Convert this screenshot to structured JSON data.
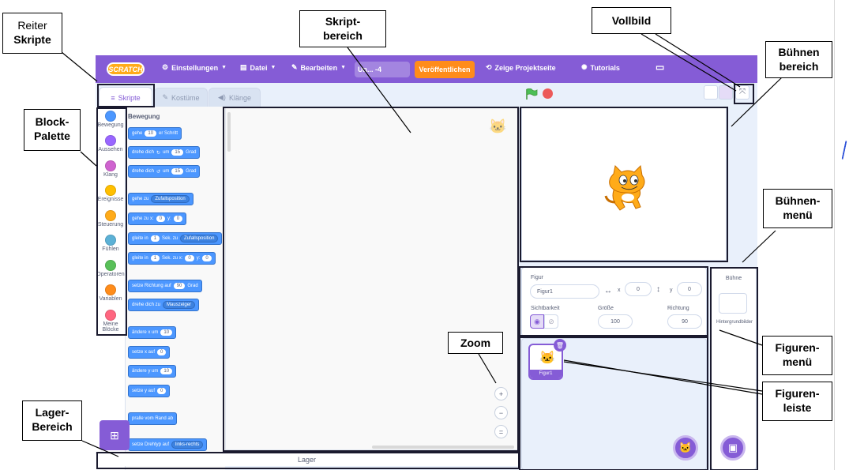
{
  "menubar": {
    "logo": "SCRATCH",
    "settings": "Einstellungen",
    "file": "Datei",
    "edit": "Bearbeiten",
    "project_title": "Un... -4",
    "publish": "Veröffentlichen",
    "project_page": "Zeige Projektseite",
    "tutorials": "Tutorials",
    "accent": "#855cd6",
    "publish_color": "#ff8c1a"
  },
  "tabs": {
    "scripts": "Skripte",
    "costumes": "Kostüme",
    "sounds": "Klänge"
  },
  "categories": [
    {
      "label": "Bewegung",
      "color": "#4c97ff"
    },
    {
      "label": "Aussehen",
      "color": "#9966ff"
    },
    {
      "label": "Klang",
      "color": "#cf63cf"
    },
    {
      "label": "Ereignisse",
      "color": "#ffbf00"
    },
    {
      "label": "Steuerung",
      "color": "#ffab19"
    },
    {
      "label": "Fühlen",
      "color": "#5cb1d6"
    },
    {
      "label": "Operatoren",
      "color": "#59c059"
    },
    {
      "label": "Variablen",
      "color": "#ff8c1a"
    },
    {
      "label": "Meine Blöcke",
      "color": "#ff6680"
    }
  ],
  "palette": {
    "heading": "Bewegung",
    "blocks": {
      "move": {
        "a": "gehe",
        "n": "10",
        "b": "er Schritt"
      },
      "turn_right": {
        "a": "drehe dich",
        "b": "um",
        "n": "15",
        "c": "Grad"
      },
      "turn_left": {
        "a": "drehe dich",
        "b": "um",
        "n": "15",
        "c": "Grad"
      },
      "goto": {
        "a": "gehe zu",
        "dd": "Zufallsposition"
      },
      "goto_xy": {
        "a": "gehe zu x:",
        "x": "0",
        "b": "y:",
        "y": "0"
      },
      "glide_to": {
        "a": "gleite in",
        "n": "1",
        "b": "Sek. zu",
        "dd": "Zufallsposition"
      },
      "glide_xy": {
        "a": "gleite in",
        "n": "1",
        "b": "Sek. zu x:",
        "x": "0",
        "c": "y:",
        "y": "0"
      },
      "point_dir": {
        "a": "setze Richtung auf",
        "n": "90",
        "b": "Grad"
      },
      "point_towards": {
        "a": "drehe dich zu",
        "dd": "Mauszeiger"
      },
      "change_x": {
        "a": "ändere x um",
        "n": "10"
      },
      "set_x": {
        "a": "setze x auf",
        "n": "0"
      },
      "change_y": {
        "a": "ändere y um",
        "n": "10"
      },
      "set_y": {
        "a": "setze y auf",
        "n": "0"
      },
      "bounce": {
        "a": "pralle vom Rand ab"
      },
      "rotation_style": {
        "a": "setze Drehtyp auf",
        "dd": "links-rechts"
      }
    }
  },
  "storage": {
    "label": "Lager"
  },
  "sprite_info": {
    "sprite_label": "Figur",
    "sprite_name": "Figur1",
    "x_label": "x",
    "x_value": "0",
    "y_label": "y",
    "y_value": "0",
    "visibility_label": "Sichtbarkeit",
    "size_label": "Größe",
    "size_value": "100",
    "direction_label": "Richtung",
    "direction_value": "90"
  },
  "sprite_list": {
    "thumb_label": "Figur1"
  },
  "stage_panel": {
    "title": "Bühne",
    "backdrops": "Hintergrundbilder"
  },
  "annotations": {
    "reiter": [
      "Reiter",
      "Skripte"
    ],
    "palette": [
      "Block-",
      "Palette"
    ],
    "lager": [
      "Lager-",
      "Bereich"
    ],
    "skript": [
      "Skript-",
      "bereich"
    ],
    "zoom": "Zoom",
    "vollbild": "Vollbild",
    "buehnenbereich": [
      "Bühnen",
      "bereich"
    ],
    "buehnenmenue": [
      "Bühnen-",
      "menü"
    ],
    "figurenmenue": [
      "Figuren-",
      "menü"
    ],
    "figurenleiste": [
      "Figuren-",
      "leiste"
    ]
  }
}
